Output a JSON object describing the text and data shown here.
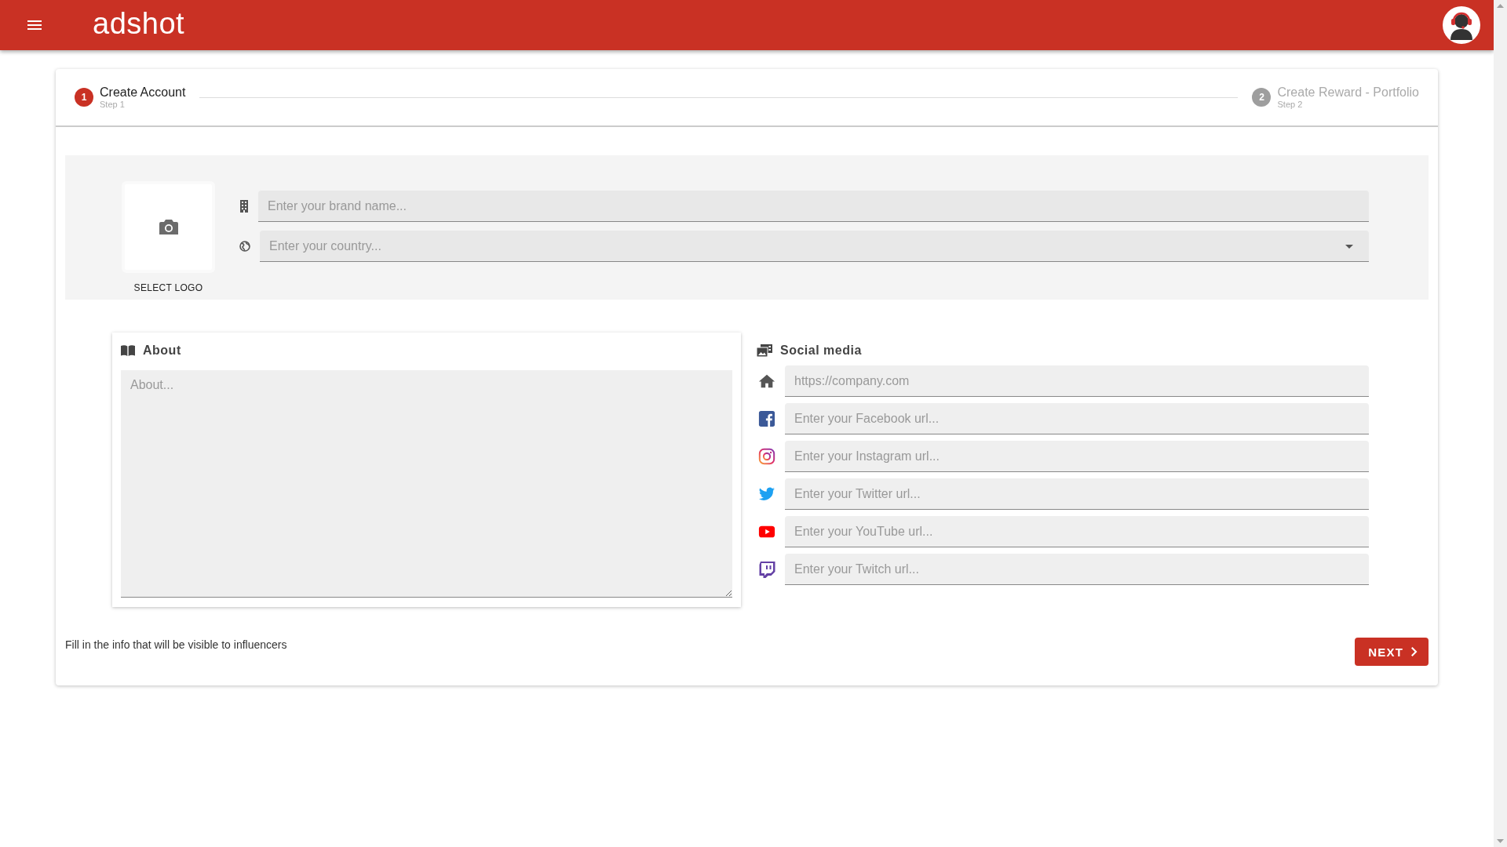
{
  "header": {
    "logo": "adshot"
  },
  "stepper": [
    {
      "number": "1",
      "label": "Create Account",
      "sublabel": "Step 1",
      "selected": true
    },
    {
      "number": "2",
      "label": "Create Reward - Portfolio",
      "sublabel": "Step 2",
      "selected": false
    }
  ],
  "brand": {
    "select_logo": "SELECT LOGO",
    "brand_name": {
      "placeholder": "Enter your brand name..."
    },
    "country": {
      "placeholder": "Enter your country..."
    }
  },
  "about": {
    "title": "About",
    "placeholder": "About..."
  },
  "social": {
    "title": "Social media",
    "links": [
      {
        "kind": "home",
        "placeholder": "https://company.com"
      },
      {
        "kind": "facebook",
        "placeholder": "Enter your Facebook url..."
      },
      {
        "kind": "instagram",
        "placeholder": "Enter your Instagram url..."
      },
      {
        "kind": "twitter",
        "placeholder": "Enter your Twitter url..."
      },
      {
        "kind": "youtube",
        "placeholder": "Enter your YouTube url..."
      },
      {
        "kind": "twitch",
        "placeholder": "Enter your Twitch url..."
      }
    ]
  },
  "footer": {
    "hint": "Fill in the info that will be visible to influencers",
    "next": "NEXT"
  }
}
